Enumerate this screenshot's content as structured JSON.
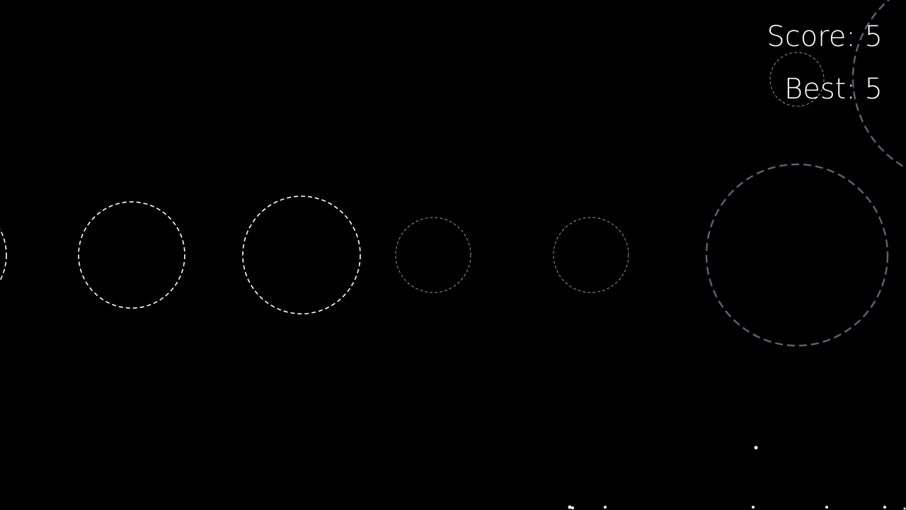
{
  "hud": {
    "score_text": "Score: 5",
    "best_text": "Best: 5"
  },
  "colors": {
    "background": "#000000",
    "text": "#ffffff",
    "ring_bright": "#ffffff",
    "ring_dim": "#8a8a8a",
    "ring_active": "#5c6670",
    "particle": "#ffffff"
  },
  "game": {
    "rings": [
      {
        "name": "ring-offscreen-left",
        "style": "bright"
      },
      {
        "name": "ring-1",
        "style": "bright"
      },
      {
        "name": "ring-2",
        "style": "bright"
      },
      {
        "name": "ring-3",
        "style": "dim"
      },
      {
        "name": "ring-4",
        "style": "dim"
      },
      {
        "name": "ring-active",
        "style": "active"
      },
      {
        "name": "ring-hud-small",
        "style": "dim"
      },
      {
        "name": "ring-top-right-partial",
        "style": "active"
      }
    ],
    "particle_count": 8
  }
}
